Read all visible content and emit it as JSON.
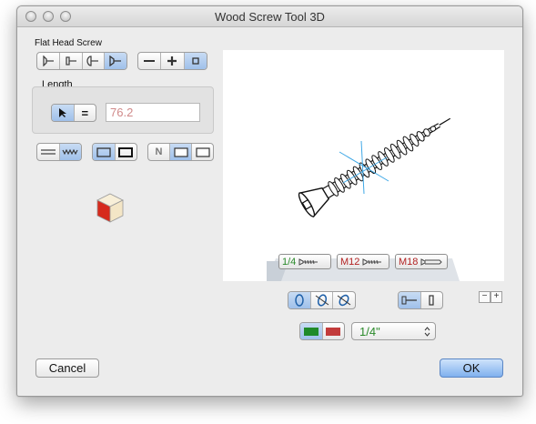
{
  "window": {
    "title": "Wood Screw Tool 3D"
  },
  "screw_type": {
    "label": "Flat Head Screw"
  },
  "length": {
    "label": "Length",
    "value": "76.2",
    "equals_symbol": "="
  },
  "thread_seg": {
    "n_label": "N"
  },
  "presets": [
    {
      "label": "1/4",
      "color": "#2a8a2a"
    },
    {
      "label": "M12",
      "color": "#b22222"
    },
    {
      "label": "M18",
      "color": "#b22222"
    }
  ],
  "size_popup": {
    "value": "1/4\""
  },
  "zoom": {
    "minus": "−",
    "plus": "+"
  },
  "buttons": {
    "cancel": "Cancel",
    "ok": "OK"
  },
  "colors": {
    "green_swatch": "#1f8a2a",
    "red_swatch": "#c23b3b",
    "cube_red": "#d62a1c",
    "cube_tan": "#f4e6c6"
  }
}
